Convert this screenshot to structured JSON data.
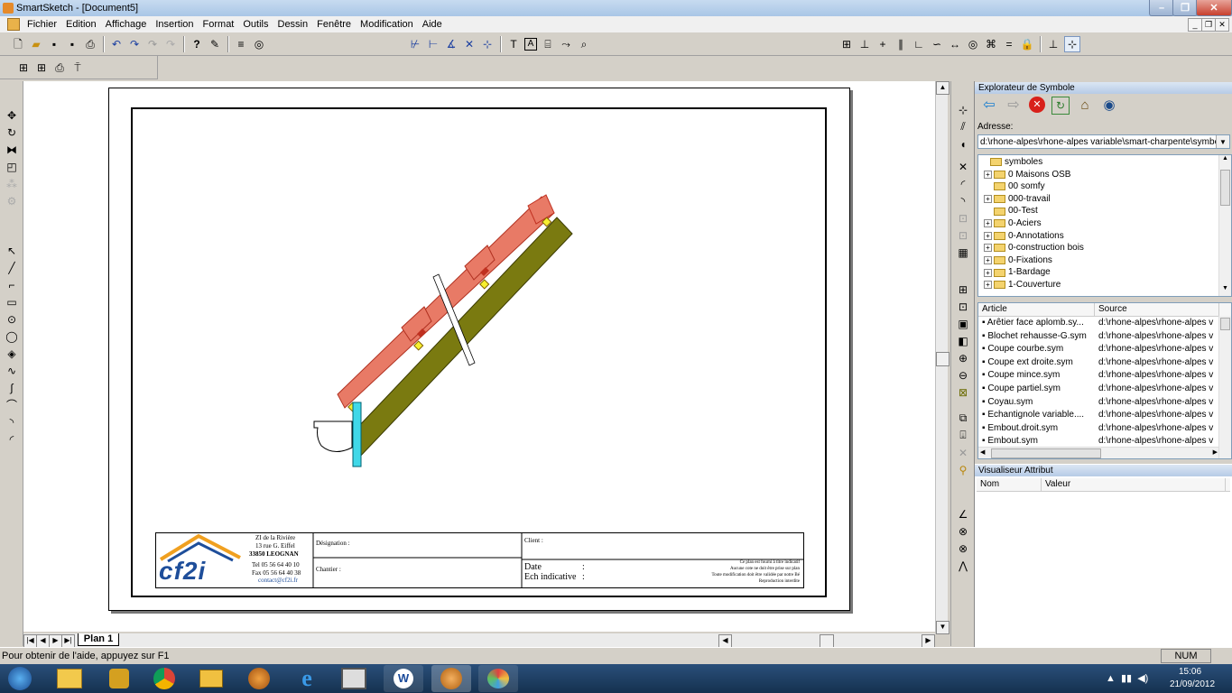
{
  "window": {
    "title": "SmartSketch - [Document5]"
  },
  "menu": [
    "Fichier",
    "Edition",
    "Affichage",
    "Insertion",
    "Format",
    "Outils",
    "Dessin",
    "Fenêtre",
    "Modification",
    "Aide"
  ],
  "explorer": {
    "title": "Explorateur de Symbole",
    "address_label": "Adresse:",
    "address_value": "d:\\rhone-alpes\\rhone-alpes variable\\smart-charpente\\symboles",
    "tree": [
      {
        "label": "symboles",
        "expander": ""
      },
      {
        "label": "0 Maisons OSB",
        "expander": "+"
      },
      {
        "label": "00 somfy",
        "expander": ""
      },
      {
        "label": "000-travail",
        "expander": "+"
      },
      {
        "label": "00-Test",
        "expander": ""
      },
      {
        "label": "0-Aciers",
        "expander": "+"
      },
      {
        "label": "0-Annotations",
        "expander": "+"
      },
      {
        "label": "0-construction bois",
        "expander": "+"
      },
      {
        "label": "0-Fixations",
        "expander": "+"
      },
      {
        "label": "1-Bardage",
        "expander": "+"
      },
      {
        "label": "1-Couverture",
        "expander": "+"
      }
    ],
    "list_headers": {
      "article": "Article",
      "source": "Source"
    },
    "list": [
      {
        "article": "Arêtier face aplomb.sy...",
        "source": "d:\\rhone-alpes\\rhone-alpes v"
      },
      {
        "article": "Blochet rehausse-G.sym",
        "source": "d:\\rhone-alpes\\rhone-alpes v"
      },
      {
        "article": "Coupe courbe.sym",
        "source": "d:\\rhone-alpes\\rhone-alpes v"
      },
      {
        "article": "Coupe ext droite.sym",
        "source": "d:\\rhone-alpes\\rhone-alpes v"
      },
      {
        "article": "Coupe mince.sym",
        "source": "d:\\rhone-alpes\\rhone-alpes v"
      },
      {
        "article": "Coupe partiel.sym",
        "source": "d:\\rhone-alpes\\rhone-alpes v"
      },
      {
        "article": "Coyau.sym",
        "source": "d:\\rhone-alpes\\rhone-alpes v"
      },
      {
        "article": "Echantignole variable....",
        "source": "d:\\rhone-alpes\\rhone-alpes v"
      },
      {
        "article": "Embout.droit.sym",
        "source": "d:\\rhone-alpes\\rhone-alpes v"
      },
      {
        "article": "Embout.sym",
        "source": "d:\\rhone-alpes\\rhone-alpes v"
      }
    ]
  },
  "attributes": {
    "title": "Visualiseur Attribut",
    "col_name": "Nom",
    "col_value": "Valeur"
  },
  "titleblock": {
    "company_lines": [
      "ZI de la Rivière",
      "13 rue G. Eiffel",
      "33850 LEOGNAN",
      "Tel 05 56 64 40 10",
      "Fax 05 56 64 40 38",
      "contact@cf2i.fr"
    ],
    "logo_text": "cf2i",
    "designation": "Désignation :",
    "chantier": "Chantier :",
    "client": "Client :",
    "date": "Date",
    "ech": "Ech indicative",
    "colon": ":",
    "notice": [
      "Ce plan est fourni à titre indicatif",
      "Aucune cote ne doit être prise sur plan",
      "Toute modification doit être validée par notre Bé",
      "Reproduction interdite"
    ]
  },
  "tabs": {
    "active": "Plan 1"
  },
  "status": {
    "help": "Pour obtenir de l'aide, appuyez sur F1",
    "num": "NUM"
  },
  "clock": {
    "time": "15:06",
    "date": "21/09/2012"
  },
  "colors": {
    "tile": "#e87a66",
    "tile_dark": "#c03020",
    "rafter": "#7a7a10",
    "gutter_post": "#40d8e8",
    "selection": "#f7f030"
  }
}
